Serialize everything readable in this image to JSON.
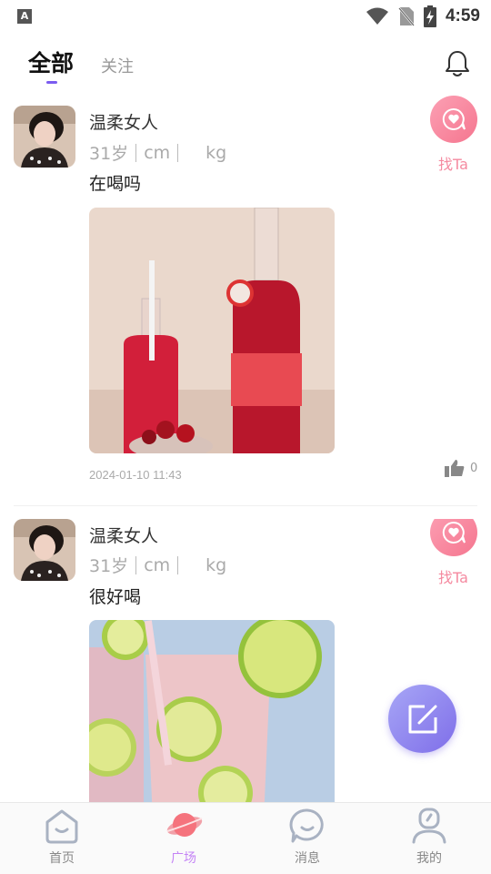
{
  "status_bar": {
    "time": "4:59",
    "app_badge": "A"
  },
  "tabs": {
    "all": "全部",
    "follow": "关注"
  },
  "posts": [
    {
      "name": "温柔女人",
      "age": "31岁",
      "height_unit": "cm",
      "weight_unit": "kg",
      "text": "在喝吗",
      "find_label": "找Ta",
      "date": "2024-01-10 11:43",
      "likes": "0"
    },
    {
      "name": "温柔女人",
      "age": "31岁",
      "height_unit": "cm",
      "weight_unit": "kg",
      "text": "很好喝",
      "find_label": "找Ta"
    }
  ],
  "bottom_nav": [
    {
      "label": "首页",
      "icon": "home-icon"
    },
    {
      "label": "广场",
      "icon": "planet-icon",
      "active": true
    },
    {
      "label": "消息",
      "icon": "message-icon"
    },
    {
      "label": "我的",
      "icon": "profile-icon"
    }
  ],
  "colors": {
    "accent": "#7b5cf0",
    "pink": "#f5768f",
    "active_nav": "#c484f5"
  }
}
